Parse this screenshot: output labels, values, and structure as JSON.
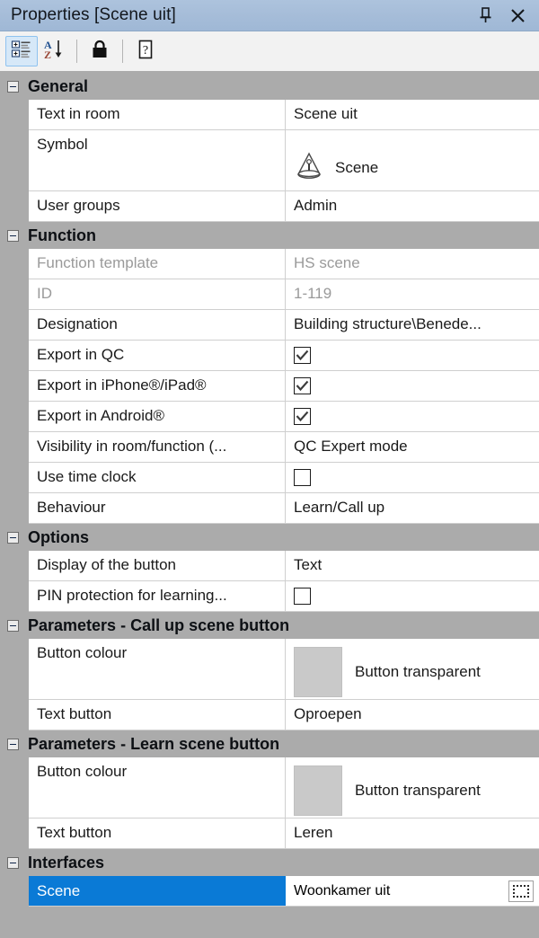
{
  "window": {
    "title": "Properties [Scene uit]",
    "pin_icon": "pin-icon",
    "close_icon": "close-icon"
  },
  "toolbar": {
    "buttons": [
      {
        "name": "categorized-view-button",
        "icon": "categorized-list-icon",
        "active": true
      },
      {
        "name": "alphabetical-sort-button",
        "icon": "sort-az-icon",
        "active": false
      },
      {
        "name": "lock-button",
        "icon": "lock-icon",
        "active": false
      },
      {
        "name": "help-button",
        "icon": "help-icon",
        "active": false
      }
    ]
  },
  "sections": [
    {
      "title": "General",
      "rows": [
        {
          "label": "Text in room",
          "value": "Scene uit",
          "type": "text"
        },
        {
          "label": "Symbol",
          "value": "Scene",
          "type": "symbol",
          "icon": "scene-lamp-icon"
        },
        {
          "label": "User groups",
          "value": "Admin",
          "type": "text"
        }
      ]
    },
    {
      "title": "Function",
      "rows": [
        {
          "label": "Function template",
          "value": "HS scene",
          "type": "text",
          "disabled": true
        },
        {
          "label": "ID",
          "value": "1-119",
          "type": "text",
          "disabled": true
        },
        {
          "label": "Designation",
          "value": "Building structure\\Benede...",
          "type": "text"
        },
        {
          "label": "Export in QC",
          "value": "",
          "type": "checkbox",
          "checked": true
        },
        {
          "label": "Export in iPhone®/iPad®",
          "value": "",
          "type": "checkbox",
          "checked": true
        },
        {
          "label": "Export in Android®",
          "value": "",
          "type": "checkbox",
          "checked": true
        },
        {
          "label": "Visibility in room/function (...",
          "value": "QC Expert mode",
          "type": "text"
        },
        {
          "label": "Use time clock",
          "value": "",
          "type": "checkbox",
          "checked": false
        },
        {
          "label": "Behaviour",
          "value": "Learn/Call up",
          "type": "text"
        }
      ]
    },
    {
      "title": "Options",
      "rows": [
        {
          "label": "Display of the button",
          "value": "Text",
          "type": "text"
        },
        {
          "label": "PIN protection for learning...",
          "value": "",
          "type": "checkbox",
          "checked": false
        }
      ]
    },
    {
      "title": "Parameters - Call up scene button",
      "rows": [
        {
          "label": "Button colour",
          "value": "Button transparent",
          "type": "colour",
          "colour": "#c9c9c9"
        },
        {
          "label": "Text button",
          "value": "Oproepen",
          "type": "text"
        }
      ]
    },
    {
      "title": "Parameters - Learn scene button",
      "rows": [
        {
          "label": "Button colour",
          "value": "Button transparent",
          "type": "colour",
          "colour": "#c9c9c9"
        },
        {
          "label": "Text button",
          "value": "Leren",
          "type": "text"
        }
      ]
    },
    {
      "title": "Interfaces",
      "rows": [
        {
          "label": "Scene",
          "value": "Woonkamer uit",
          "type": "picker",
          "selected": true,
          "picker_icon": "select-target-icon"
        }
      ]
    }
  ],
  "colors": {
    "titlebar": "#a5bcd8",
    "section_header": "#ababab",
    "selection": "#0a7ad6",
    "grid_line": "#cfcfcf"
  }
}
